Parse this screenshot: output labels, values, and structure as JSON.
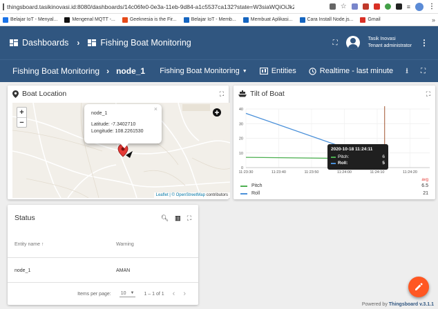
{
  "browser": {
    "url": "thingsboard.tasikinovasi.id:8080/dashboards/14c06fe0-0e3a-11eb-9d84-a1c5537ca132?state=W3siaWQiOiJkZ...",
    "bookmarks": [
      {
        "label": "Belajar IoT - Menyal...",
        "color": "#1a73e8"
      },
      {
        "label": "Mengenal MQTT -...",
        "color": "#111111"
      },
      {
        "label": "Geeknesia is the Fir...",
        "color": "#e64a19"
      },
      {
        "label": "Belajar IoT - Memb...",
        "color": "#1565c0"
      },
      {
        "label": "Membuat Aplikasi...",
        "color": "#1565c0"
      },
      {
        "label": "Cara Install Node.js...",
        "color": "#1565c0"
      },
      {
        "label": "Gmail",
        "color": "#d93025"
      }
    ],
    "bookmarks_more": "»"
  },
  "app": {
    "section": "Dashboards",
    "title": "Fishing Boat Monitoring",
    "user_name": "Tasik Inovasi",
    "user_role": "Tenant administrator"
  },
  "dashboard": {
    "title": "Fishing Boat Monitoring",
    "state": "node_1",
    "state_selector": "Fishing Boat Monitoring",
    "entities_label": "Entities",
    "timewindow_label": "Realtime - last minute"
  },
  "map_widget": {
    "title": "Boat Location",
    "popup_name": "node_1",
    "latitude_label": "Latitude:",
    "latitude": "-7.3402710",
    "longitude_label": "Longitude:",
    "longitude": "108.2261530",
    "attribution_prefix": "Leaflet | © ",
    "attribution_link": "OpenStreetMap",
    "attribution_suffix": " contributors",
    "zoom_in": "+",
    "zoom_out": "−"
  },
  "chart_widget": {
    "title": "Tilt of Boat",
    "legend_header": "avg",
    "legend": [
      {
        "name": "Pitch",
        "avg": "6.5",
        "color": "#4caf50"
      },
      {
        "name": "Roll",
        "avg": "21",
        "color": "#4a90d9"
      }
    ],
    "tooltip": {
      "time": "2020-10-18 11:24:11",
      "rows": [
        {
          "name": "Pitch:",
          "value": "6",
          "color": "#4caf50"
        },
        {
          "name": "Roll:",
          "value": "5",
          "color": "#4a90d9"
        }
      ]
    }
  },
  "chart_data": {
    "type": "line",
    "title": "Tilt of Boat",
    "xlabel": "",
    "ylabel": "",
    "x_ticks": [
      "11:23:30",
      "11:23:40",
      "11:23:50",
      "11:24:00",
      "11:24:10",
      "11:24:20"
    ],
    "y_ticks": [
      0,
      10,
      20,
      30,
      40
    ],
    "ylim": [
      0,
      40
    ],
    "series": [
      {
        "name": "Pitch",
        "color": "#4caf50",
        "points": [
          [
            "11:23:30",
            7
          ],
          [
            "11:24:11",
            6
          ]
        ]
      },
      {
        "name": "Roll",
        "color": "#4a90d9",
        "points": [
          [
            "11:23:30",
            37
          ],
          [
            "11:24:11",
            5
          ]
        ]
      }
    ],
    "grid": true,
    "legend_position": "bottom"
  },
  "status_widget": {
    "title": "Status",
    "columns": [
      "Entity name ↑",
      "Warning"
    ],
    "rows": [
      [
        "node_1",
        "AMAN"
      ]
    ],
    "items_per_page_label": "Items per page:",
    "items_per_page": "10",
    "range": "1 – 1 of 1"
  },
  "footer": {
    "prefix": "Powered by ",
    "brand": "Thingsboard v.3.1.1"
  }
}
